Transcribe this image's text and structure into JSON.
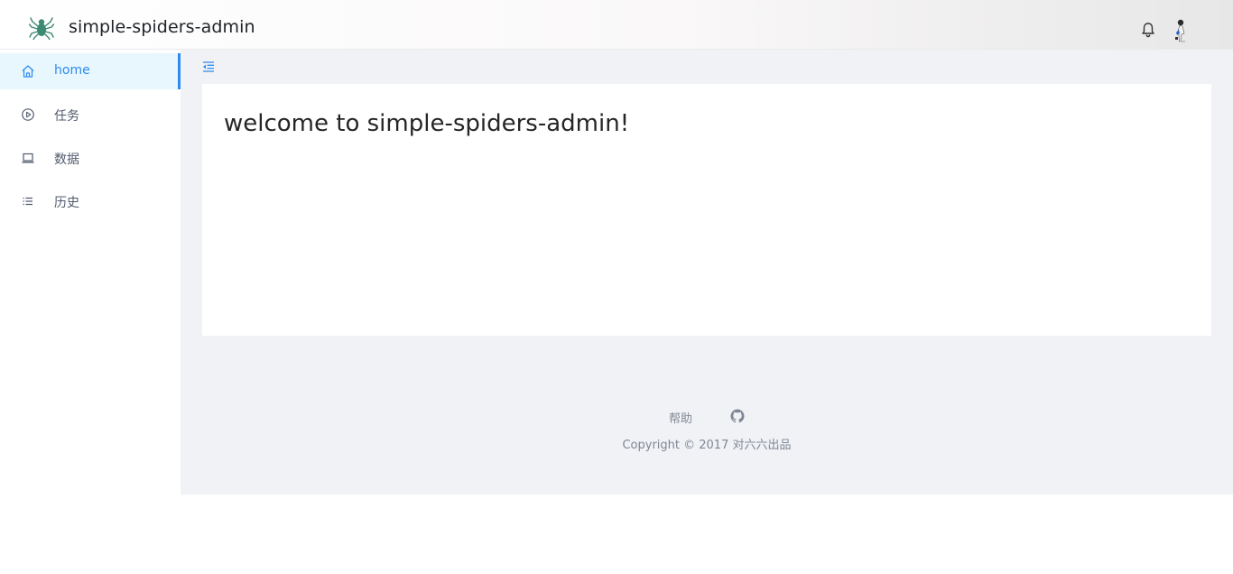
{
  "header": {
    "title": "simple-spiders-admin",
    "logo_icon": "spider-icon",
    "notification_icon": "bell-icon",
    "avatar": "user-avatar"
  },
  "sidebar": {
    "items": [
      {
        "label": "home",
        "icon": "home-icon",
        "active": true
      },
      {
        "label": "任务",
        "icon": "play-circle-icon",
        "active": false
      },
      {
        "label": "数据",
        "icon": "laptop-icon",
        "active": false
      },
      {
        "label": "历史",
        "icon": "list-icon",
        "active": false
      }
    ]
  },
  "main": {
    "collapse_icon": "menu-fold-icon",
    "welcome": "welcome to simple-spiders-admin!"
  },
  "footer": {
    "help": "帮助",
    "github_icon": "github-icon",
    "copyright": "Copyright © 2017 对六六出品"
  },
  "colors": {
    "accent": "#2d8cf0",
    "active_bg": "#e8f6fe",
    "content_bg": "#f0f2f5",
    "logo": "#3d8a73"
  }
}
